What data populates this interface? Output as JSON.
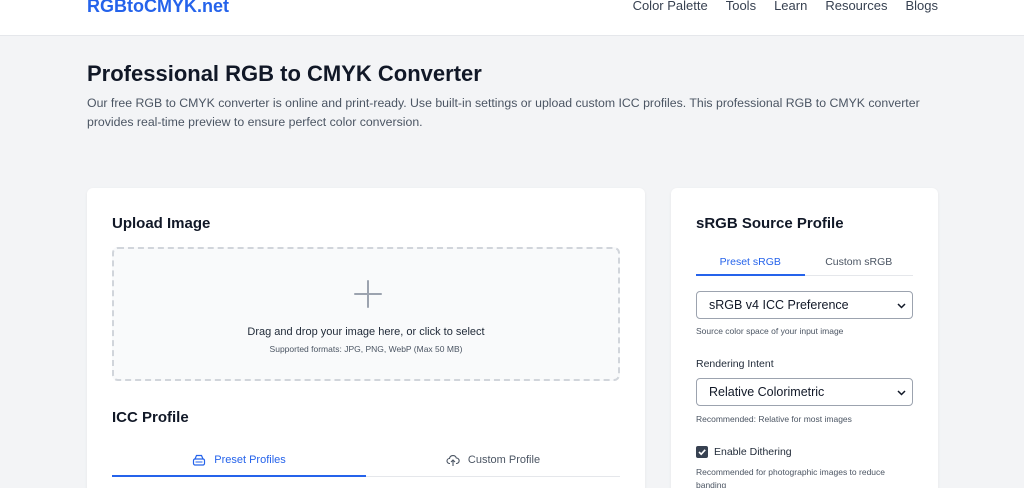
{
  "header": {
    "logo": "RGBtoCMYK.net",
    "nav": [
      "Color Palette",
      "Tools",
      "Learn",
      "Resources",
      "Blogs"
    ]
  },
  "hero": {
    "title": "Professional RGB to CMYK Converter",
    "description": "Our free RGB to CMYK converter is online and print-ready. Use built-in settings or upload custom ICC profiles. This professional RGB to CMYK converter provides real-time preview to ensure perfect color conversion."
  },
  "upload": {
    "title": "Upload Image",
    "main_text": "Drag and drop your image here, or click to select",
    "formats": "Supported formats: JPG, PNG, WebP (Max 50 MB)"
  },
  "icc": {
    "title": "ICC Profile",
    "tabs": [
      {
        "label": "Preset Profiles",
        "icon": "drive-icon",
        "active": true
      },
      {
        "label": "Custom Profile",
        "icon": "cloud-upload-icon",
        "active": false
      }
    ]
  },
  "source": {
    "title": "sRGB Source Profile",
    "tabs": [
      {
        "label": "Preset sRGB",
        "active": true
      },
      {
        "label": "Custom sRGB",
        "active": false
      }
    ],
    "profile_value": "sRGB v4 ICC Preference",
    "profile_hint": "Source color space of your input image",
    "intent_label": "Rendering Intent",
    "intent_value": "Relative Colorimetric",
    "intent_hint": "Recommended: Relative for most images",
    "dithering_label": "Enable Dithering",
    "dithering_checked": true,
    "dithering_hint": "Recommended for photographic images to reduce banding"
  },
  "colors": {
    "accent": "#2563eb",
    "background": "#f3f4f6"
  }
}
